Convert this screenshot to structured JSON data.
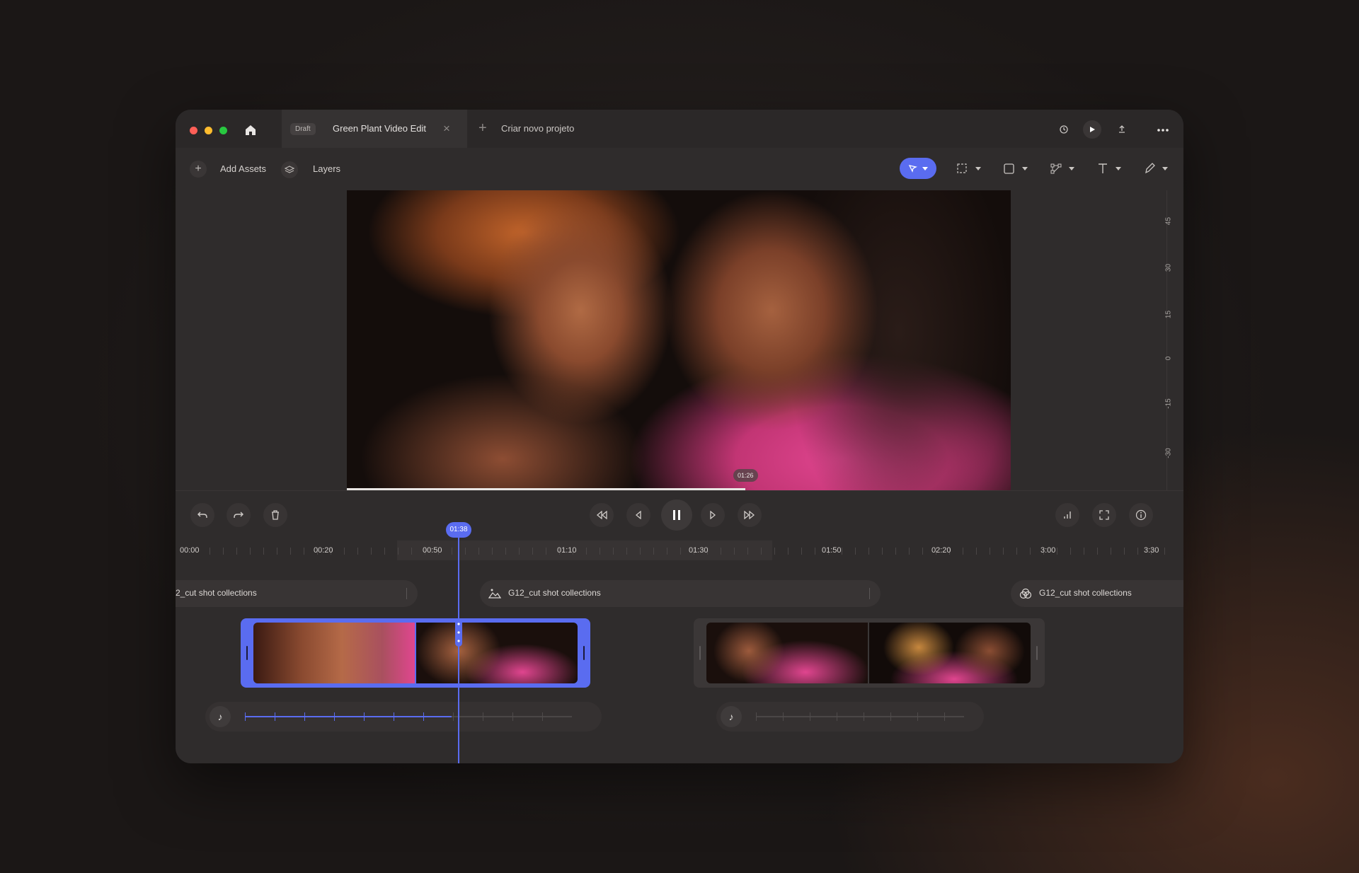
{
  "window": {
    "traffic_lights": [
      "#ff5f57",
      "#febc2e",
      "#28c840"
    ],
    "accent": "#5a6cf0"
  },
  "tabs": {
    "active": {
      "badge": "Draft",
      "title": "Green Plant Video Edit"
    },
    "new_tab_label": "Criar novo projeto"
  },
  "titlebar_right": [
    "history-icon",
    "play-icon",
    "share-icon",
    "more-icon"
  ],
  "toolbar": {
    "add_assets": "Add Assets",
    "layers": "Layers",
    "tools": [
      "select-tool",
      "crop-tool",
      "shape-tool",
      "transform-tool",
      "text-tool",
      "pen-tool"
    ]
  },
  "preview": {
    "time_badge": "01:26",
    "progress": 0.6
  },
  "ruler_labels": [
    "45",
    "30",
    "15",
    "0",
    "-15",
    "-30"
  ],
  "playback": {
    "left": [
      "undo-icon",
      "redo-icon",
      "delete-icon"
    ],
    "center": [
      "rewind-icon",
      "step-back-icon",
      "pause-icon",
      "step-forward-icon",
      "fast-forward-icon"
    ],
    "right": [
      "levels-icon",
      "fullscreen-icon",
      "info-icon"
    ]
  },
  "timeline": {
    "playhead_time": "01:38",
    "ticks": [
      "00:00",
      "00:20",
      "00:50",
      "01:10",
      "01:30",
      "01:50",
      "02:20",
      "3:00",
      "3:30"
    ],
    "clip_groups": [
      {
        "label": "2_cut shot collections",
        "icon": ""
      },
      {
        "label": "G12_cut shot collections",
        "icon": "image-icon"
      },
      {
        "label": "G12_cut shot collections",
        "icon": "filter-icon"
      }
    ]
  }
}
